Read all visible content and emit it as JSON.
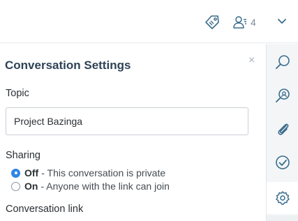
{
  "header": {
    "participants_count": "4",
    "icons": [
      "tag-icon",
      "users-icon",
      "chevron-down-icon"
    ]
  },
  "panel": {
    "title": "Conversation Settings",
    "close_label": "×",
    "topic": {
      "label": "Topic",
      "value": "Project Bazinga"
    },
    "sharing": {
      "label": "Sharing",
      "options": [
        {
          "key": "Off",
          "description": "- This conversation is private",
          "selected": true
        },
        {
          "key": "On",
          "description": "- Anyone with the link can join",
          "selected": false
        }
      ]
    },
    "link_label": "Conversation link"
  },
  "sidebar": {
    "items": [
      "search-icon",
      "find-in-conversation-icon",
      "paperclip-icon",
      "checkmark-icon",
      "gear-icon"
    ],
    "active": "gear-icon"
  },
  "colors": {
    "accent": "#2f86e6",
    "title": "#2f4357",
    "icon": "#3a6d8c"
  }
}
